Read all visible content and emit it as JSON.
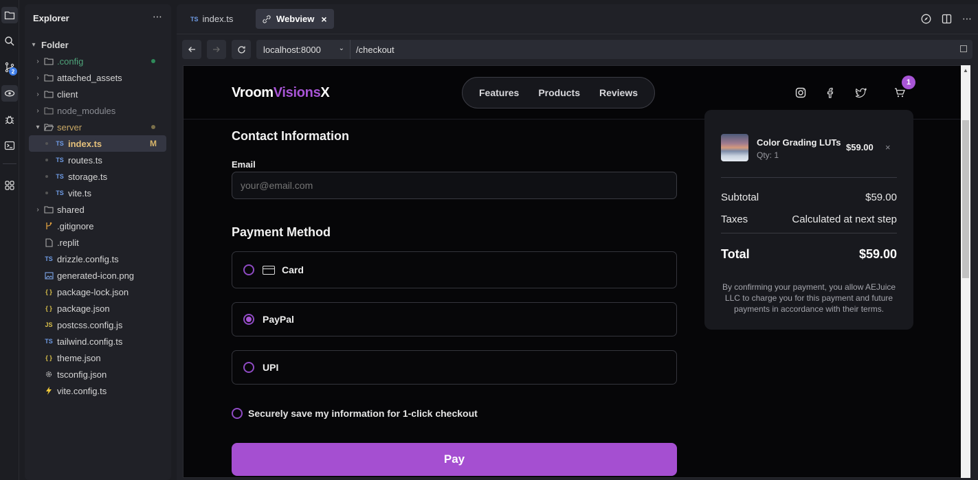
{
  "activity": {
    "scm_badge": "2"
  },
  "explorer": {
    "title": "Explorer",
    "more": "⋯",
    "items": [
      {
        "label": "Folder",
        "kind": "root"
      },
      {
        "label": ".config",
        "kind": "folder"
      },
      {
        "label": "attached_assets",
        "kind": "folder"
      },
      {
        "label": "client",
        "kind": "folder"
      },
      {
        "label": "node_modules",
        "kind": "folder"
      },
      {
        "label": "server",
        "kind": "folder-open"
      },
      {
        "label": "index.ts",
        "kind": "ts",
        "badge": "M"
      },
      {
        "label": "routes.ts",
        "kind": "ts"
      },
      {
        "label": "storage.ts",
        "kind": "ts"
      },
      {
        "label": "vite.ts",
        "kind": "ts"
      },
      {
        "label": "shared",
        "kind": "folder"
      },
      {
        "label": ".gitignore",
        "kind": "git"
      },
      {
        "label": ".replit",
        "kind": "file"
      },
      {
        "label": "drizzle.config.ts",
        "kind": "ts"
      },
      {
        "label": "generated-icon.png",
        "kind": "image"
      },
      {
        "label": "package-lock.json",
        "kind": "json"
      },
      {
        "label": "package.json",
        "kind": "json"
      },
      {
        "label": "postcss.config.js",
        "kind": "js"
      },
      {
        "label": "tailwind.config.ts",
        "kind": "ts"
      },
      {
        "label": "theme.json",
        "kind": "json"
      },
      {
        "label": "tsconfig.json",
        "kind": "gear"
      },
      {
        "label": "vite.config.ts",
        "kind": "bolt"
      }
    ]
  },
  "tabs": {
    "index": "index.ts",
    "webview": "Webview",
    "ts_badge": "TS",
    "close": "×"
  },
  "urlbar": {
    "host": "localhost:8000",
    "path": "/checkout"
  },
  "site": {
    "logo_a": "Vroom",
    "logo_b": "Visions",
    "logo_c": "X",
    "nav": [
      "Features",
      "Products",
      "Reviews"
    ],
    "cart_count": "1"
  },
  "checkout": {
    "contact_title": "Contact Information",
    "email_label": "Email",
    "email_placeholder": "your@email.com",
    "payment_title": "Payment Method",
    "options": {
      "card": "Card",
      "paypal": "PayPal",
      "upi": "UPI"
    },
    "save_label": "Securely save my information for 1-click checkout",
    "pay_button": "Pay"
  },
  "summary": {
    "item_name": "Color Grading LUTs",
    "item_qty": "Qty: 1",
    "item_price": "$59.00",
    "remove": "×",
    "subtotal_label": "Subtotal",
    "subtotal_value": "$59.00",
    "taxes_label": "Taxes",
    "taxes_value": "Calculated at next step",
    "total_label": "Total",
    "total_value": "$59.00",
    "terms": "By confirming your payment, you allow AEJuice LLC to charge you for this payment and future payments in accordance with their terms."
  },
  "colors": {
    "accent": "#a855d6",
    "pay_button": "#a54fd1",
    "modified": "#d8b56a",
    "ts_blue": "#6f9ce6"
  }
}
